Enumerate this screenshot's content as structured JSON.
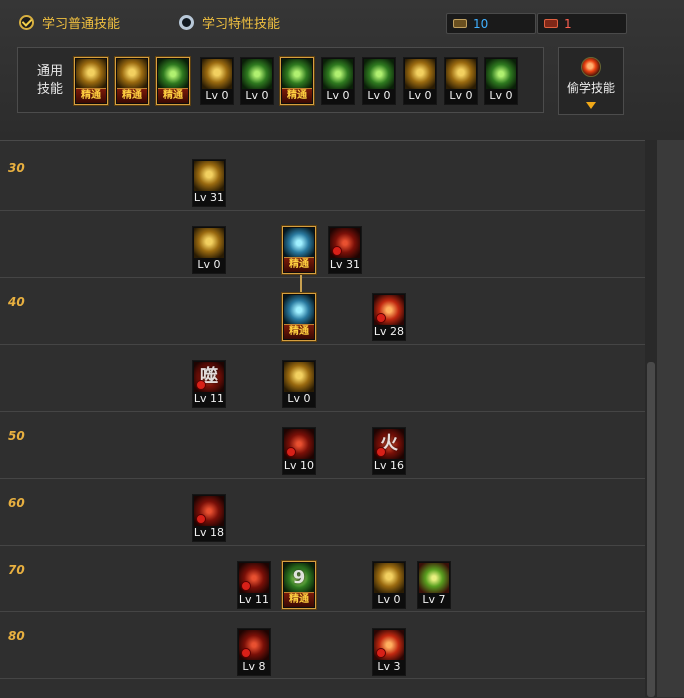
{
  "tabs": {
    "normal_label": "学习普通技能",
    "trait_label": "学习特性技能"
  },
  "points": {
    "sp_value": "10",
    "tp_value": "1"
  },
  "common_skills": {
    "label": "通用技能",
    "items": [
      {
        "theme": "gold",
        "lv": "",
        "master": "精通"
      },
      {
        "theme": "gold",
        "lv": "",
        "master": "精通"
      },
      {
        "theme": "green",
        "lv": "",
        "master": "精通"
      },
      {
        "theme": "gold",
        "lv": "Lv 0",
        "master": ""
      },
      {
        "theme": "green",
        "lv": "Lv 0",
        "master": ""
      },
      {
        "theme": "green",
        "lv": "",
        "master": "精通"
      },
      {
        "theme": "green",
        "lv": "Lv 0",
        "master": ""
      },
      {
        "theme": "green",
        "lv": "Lv 0",
        "master": ""
      },
      {
        "theme": "gold",
        "lv": "Lv 0",
        "master": ""
      },
      {
        "theme": "gold",
        "lv": "Lv 0",
        "master": ""
      },
      {
        "theme": "green",
        "lv": "Lv 0",
        "master": ""
      }
    ]
  },
  "steal_button": {
    "label": "偷学技能"
  },
  "tree": {
    "level_labels": [
      "30",
      "40",
      "50",
      "60",
      "70",
      "80"
    ],
    "skills": [
      {
        "lv": "Lv 31",
        "master": "",
        "theme": "gold",
        "glyph": ""
      },
      {
        "lv": "Lv 0",
        "master": "",
        "theme": "gold",
        "glyph": ""
      },
      {
        "lv": "",
        "master": "精通",
        "theme": "cyan",
        "glyph": ""
      },
      {
        "lv": "Lv 31",
        "master": "",
        "theme": "dred",
        "glyph": ""
      },
      {
        "lv": "",
        "master": "精通",
        "theme": "cyan",
        "glyph": ""
      },
      {
        "lv": "Lv 28",
        "master": "",
        "theme": "red",
        "glyph": ""
      },
      {
        "lv": "Lv 11",
        "master": "",
        "theme": "dred",
        "glyph": "噬"
      },
      {
        "lv": "Lv 0",
        "master": "",
        "theme": "gold",
        "glyph": ""
      },
      {
        "lv": "Lv 10",
        "master": "",
        "theme": "dred",
        "glyph": ""
      },
      {
        "lv": "Lv 16",
        "master": "",
        "theme": "dred",
        "glyph": "火"
      },
      {
        "lv": "Lv 18",
        "master": "",
        "theme": "dred",
        "glyph": ""
      },
      {
        "lv": "Lv 11",
        "master": "",
        "theme": "dred",
        "glyph": ""
      },
      {
        "lv": "",
        "master": "精通",
        "theme": "green",
        "glyph": "9"
      },
      {
        "lv": "Lv 0",
        "master": "",
        "theme": "gold",
        "glyph": ""
      },
      {
        "lv": "Lv 7",
        "master": "",
        "theme": "gren2",
        "glyph": ""
      },
      {
        "lv": "Lv 8",
        "master": "",
        "theme": "dred",
        "glyph": ""
      },
      {
        "lv": "Lv 3",
        "master": "",
        "theme": "red",
        "glyph": ""
      }
    ]
  }
}
